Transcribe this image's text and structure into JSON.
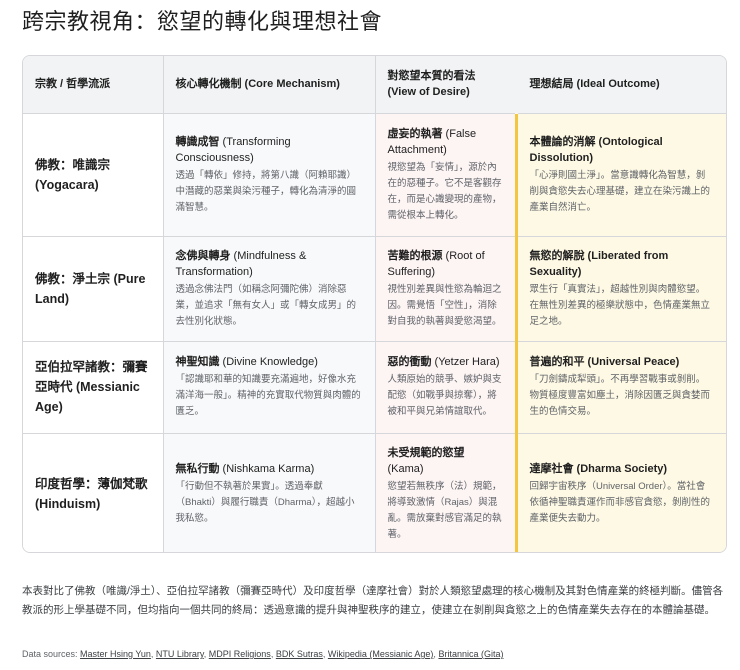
{
  "title": "跨宗教視角：慾望的轉化與理想社會",
  "headers": [
    "宗教 / 哲學流派",
    "核心轉化機制 (Core Mechanism)",
    "對慾望本質的看法 (View of Desire)",
    "理想結局 (Ideal Outcome)"
  ],
  "rows": [
    {
      "school": "佛教：唯識宗 (Yogacara)",
      "mechanism": {
        "zh": "轉識成智",
        "en": " (Transforming Consciousness)",
        "desc": "透過「轉依」修持，將第八識（阿賴耶識）中潛藏的惡業與染污種子，轉化為清淨的圓滿智慧。"
      },
      "view": {
        "zh": "虛妄的執著",
        "en": " (False Attachment)",
        "desc": "視慾望為「妄情」，源於內在的惡種子。它不是客觀存在，而是心識變現的產物，需從根本上轉化。"
      },
      "outcome": {
        "title": "本體論的消解 (Ontological Dissolution)",
        "desc": "「心淨則國土淨」。當意識轉化為智慧，剝削與貪慾失去心理基礎，建立在染污識上的產業自然消亡。"
      }
    },
    {
      "school": "佛教：淨土宗 (Pure Land)",
      "mechanism": {
        "zh": "念佛與轉身",
        "en": " (Mindfulness & Transformation)",
        "desc": "透過念佛法門（如稱念阿彌陀佛）消除惡業，並追求「無有女人」或「轉女成男」的去性別化狀態。"
      },
      "view": {
        "zh": "苦難的根源",
        "en": " (Root of Suffering)",
        "desc": "視性別差異與性慾為輪迴之因。需覺悟「空性」，消除對自我的執著與愛慾渴望。"
      },
      "outcome": {
        "title": "無慾的解脫 (Liberated from Sexuality)",
        "desc": "眾生行「真實法」，超越性別與肉體慾望。在無性別差異的極樂狀態中，色情產業無立足之地。"
      }
    },
    {
      "school": "亞伯拉罕諸教：彌賽亞時代 (Messianic Age)",
      "mechanism": {
        "zh": "神聖知識",
        "en": " (Divine Knowledge)",
        "desc": "「認識耶和華的知識要充滿遍地，好像水充滿洋海一般」。精神的充實取代物質與肉體的匱乏。"
      },
      "view": {
        "zh": "惡的衝動",
        "en": " (Yetzer Hara)",
        "desc": "人類原始的競爭、嫉妒與支配慾（如戰爭與掠奪），將被和平與兄弟情誼取代。"
      },
      "outcome": {
        "title": "普遍的和平 (Universal Peace)",
        "desc": "「刀劍鑄成犁頭」。不再學習戰事或剝削。物質極度豐富如塵土，消除因匱乏與貪婪而生的色情交易。"
      }
    },
    {
      "school": "印度哲學：薄伽梵歌 (Hinduism)",
      "mechanism": {
        "zh": "無私行動",
        "en": " (Nishkama Karma)",
        "desc": "「行動但不執著於果實」。透過奉獻（Bhakti）與履行職責（Dharma），超越小我私慾。"
      },
      "view": {
        "zh": "未受規範的慾望",
        "en": " (Kama)",
        "desc": "慾望若無秩序（法）規範，將導致激情（Rajas）與混亂。需放棄對感官滿足的執著。"
      },
      "outcome": {
        "title": "達摩社會 (Dharma Society)",
        "desc": "回歸宇宙秩序（Universal Order）。當社會依循神聖職責運作而非感官貪慾，剝削性的產業便失去動力。"
      }
    }
  ],
  "note": "本表對比了佛教（唯識/淨土）、亞伯拉罕諸教（彌賽亞時代）及印度哲學（達摩社會）對於人類慾望處理的核心機制及其對色情產業的終極判斷。儘管各教派的形上學基礎不同，但均指向一個共同的終局：透過意識的提升與神聖秩序的建立，使建立在剝削與貪慾之上的色情產業失去存在的本體論基礎。",
  "sources": {
    "label": "Data sources: ",
    "links": [
      "Master Hsing Yun",
      "NTU Library",
      "MDPI Religions",
      "BDK Sutras",
      "Wikipedia (Messianic Age)",
      "Britannica (Gita)"
    ]
  }
}
